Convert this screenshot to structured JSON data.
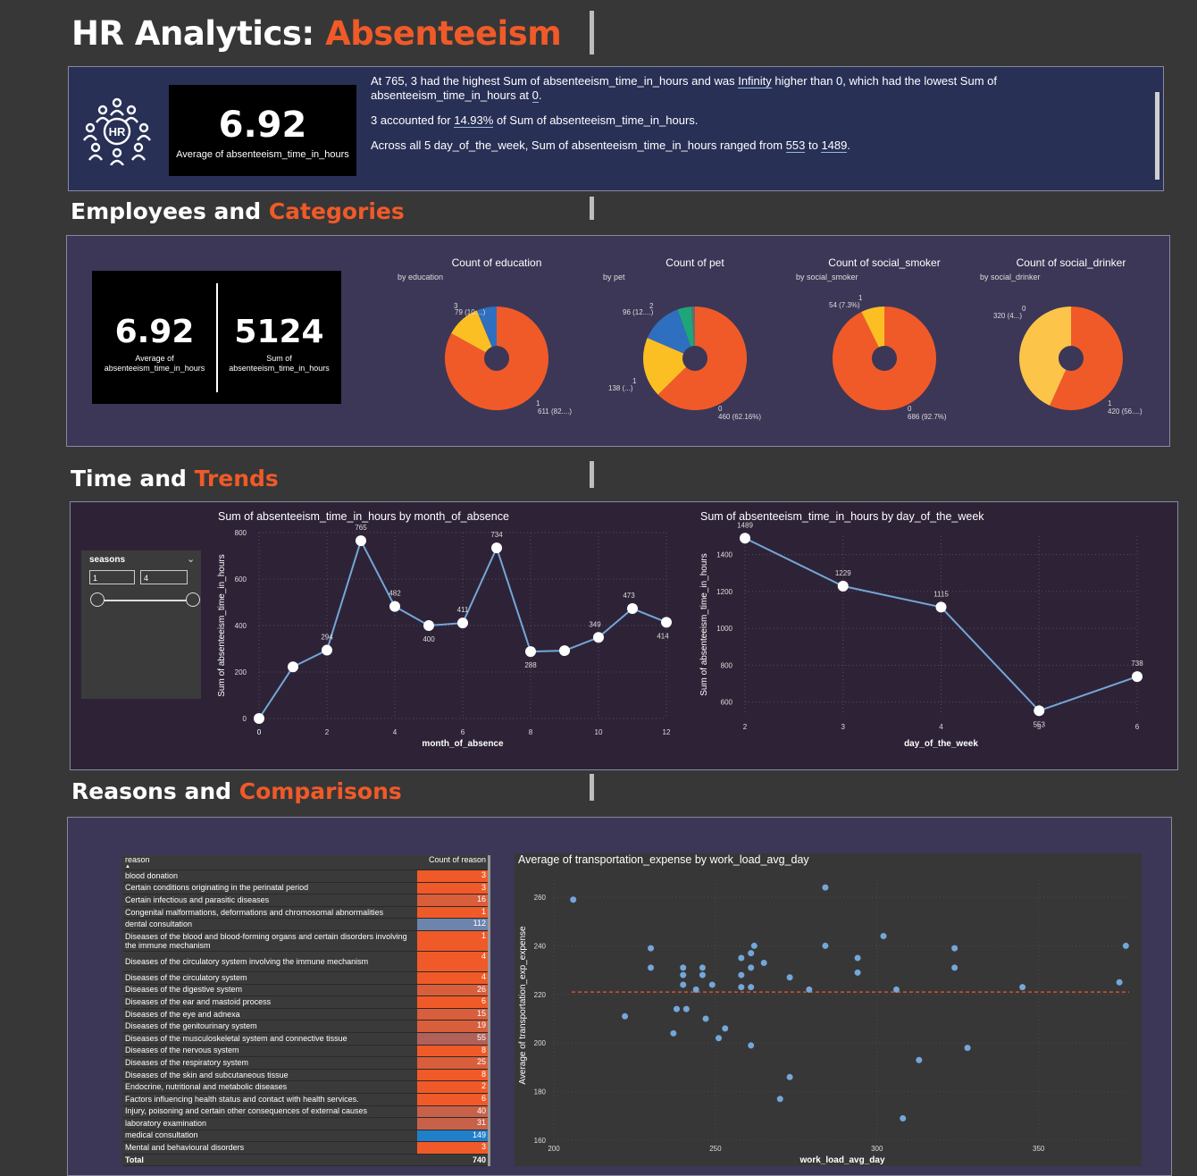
{
  "header": {
    "title_main": "HR Analytics: ",
    "title_accent": "Absenteeism"
  },
  "top_kpi": {
    "value": "6.92",
    "label": "Average of absenteeism_time_in_hours"
  },
  "insights": {
    "line1a": "At 765, 3 had the highest Sum of absenteeism_time_in_hours and was ",
    "line1b": "Infinity",
    "line1c": " higher than 0, which had the lowest Sum of",
    "line1d": "absenteeism_time_in_hours at ",
    "line1e": "0",
    "line1f": ".",
    "line2a": "3 accounted for ",
    "line2b": "14.93%",
    "line2c": " of Sum of absenteeism_time_in_hours.",
    "line3a": "Across all 5 day_of_the_week, Sum of absenteeism_time_in_hours ranged from ",
    "line3b": "553",
    "line3c": " to ",
    "line3d": "1489",
    "line3e": "."
  },
  "sections": {
    "employees_a": "Employees and ",
    "employees_b": "Categories",
    "time_a": "Time and ",
    "time_b": "Trends",
    "reasons_a": "Reasons and ",
    "reasons_b": "Comparisons"
  },
  "emp_kpis": [
    {
      "value": "6.92",
      "label1": "Average of",
      "label2": "absenteeism_time_in_hours"
    },
    {
      "value": "5124",
      "label1": "Sum of",
      "label2": "absenteeism_time_in_hours"
    }
  ],
  "donuts": [
    {
      "title": "Count of education",
      "subtitle": "by education",
      "slices": [
        {
          "name": "1",
          "value": 611,
          "color": "#f05a28"
        },
        {
          "name": "3",
          "value": 79,
          "color": "#fbbf24"
        },
        {
          "name": "2",
          "value": 46,
          "color": "#2f6fbf"
        }
      ],
      "labels": [
        {
          "text1": "3",
          "text2": "79 (10....)"
        },
        {
          "text1": "1",
          "text2": "611 (82....)"
        }
      ]
    },
    {
      "title": "Count of pet",
      "subtitle": "by pet",
      "slices": [
        {
          "name": "0",
          "value": 460,
          "color": "#f05a28"
        },
        {
          "name": "1",
          "value": 138,
          "color": "#fbbf24"
        },
        {
          "name": "2",
          "value": 96,
          "color": "#2f6fbf"
        },
        {
          "name": "4",
          "value": 32,
          "color": "#1ea67a"
        },
        {
          "name": "5",
          "value": 8,
          "color": "#6b6b6b"
        }
      ],
      "labels": [
        {
          "text1": "2",
          "text2": "96 (12....)"
        },
        {
          "text1": "1",
          "text2": "138 (...)"
        },
        {
          "text1": "0",
          "text2": "460 (62.16%)"
        }
      ]
    },
    {
      "title": "Count of social_smoker",
      "subtitle": "by social_smoker",
      "slices": [
        {
          "name": "0",
          "value": 686,
          "color": "#f05a28"
        },
        {
          "name": "1",
          "value": 54,
          "color": "#fbbf24"
        }
      ],
      "labels": [
        {
          "text1": "1",
          "text2": "54 (7.3%)"
        },
        {
          "text1": "0",
          "text2": "686 (92.7%)"
        }
      ]
    },
    {
      "title": "Count of social_drinker",
      "subtitle": "by social_drinker",
      "slices": [
        {
          "name": "1",
          "value": 420,
          "color": "#f05a28"
        },
        {
          "name": "0",
          "value": 320,
          "color": "#fdc44a"
        }
      ],
      "labels": [
        {
          "text1": "0",
          "text2": "320 (4...)"
        },
        {
          "text1": "1",
          "text2": "420 (56....)"
        }
      ]
    }
  ],
  "slicer": {
    "title": "seasons",
    "min": "1",
    "max": "4",
    "chevron": "chevron-down-icon"
  },
  "chart_data": [
    {
      "type": "line",
      "title": "Sum of absenteeism_time_in_hours by month_of_absence",
      "xlabel": "month_of_absence",
      "ylabel": "Sum of absenteeism_time_in_hours",
      "x": [
        0,
        1,
        2,
        3,
        4,
        5,
        6,
        7,
        8,
        9,
        10,
        11,
        12
      ],
      "values": [
        0,
        222,
        294,
        765,
        482,
        400,
        411,
        734,
        288,
        292,
        349,
        473,
        414
      ],
      "labels": [
        "0",
        "",
        "294",
        "765",
        "482",
        "400",
        "411",
        "734",
        "288",
        "",
        "349",
        "473",
        "414"
      ],
      "xticks": [
        "0",
        "2",
        "4",
        "6",
        "8",
        "10",
        "12"
      ],
      "yticks": [
        "0",
        "200",
        "400",
        "600",
        "800"
      ],
      "xlim": [
        0,
        12
      ],
      "ylim": [
        0,
        800
      ]
    },
    {
      "type": "line",
      "title": "Sum of absenteeism_time_in_hours by day_of_the_week",
      "xlabel": "day_of_the_week",
      "ylabel": "Sum of absenteeism_time_in_hours",
      "x": [
        2,
        3,
        4,
        5,
        6
      ],
      "values": [
        1489,
        1229,
        1115,
        553,
        738
      ],
      "labels": [
        "1489",
        "1229",
        "1115",
        "553",
        "738"
      ],
      "xticks": [
        "2",
        "3",
        "4",
        "5",
        "6"
      ],
      "yticks": [
        "600",
        "800",
        "1000",
        "1200",
        "1400"
      ],
      "xlim": [
        2,
        6
      ],
      "ylim": [
        540,
        1500
      ]
    },
    {
      "type": "table",
      "header": [
        "reason",
        "Count of reason"
      ],
      "rows": [
        [
          "blood donation",
          "3"
        ],
        [
          "Certain conditions originating in the perinatal period",
          "3"
        ],
        [
          "Certain infectious and parasitic diseases",
          "16"
        ],
        [
          "Congenital malformations, deformations and chromosomal abnormalities",
          "1"
        ],
        [
          "dental consultation",
          "112"
        ],
        [
          "Diseases of the blood and blood-forming organs and certain disorders involving the immune mechanism",
          "1"
        ],
        [
          "Diseases of the circulatory system involving the immune mechanism",
          "4"
        ],
        [
          "Diseases of the circulatory system",
          "4"
        ],
        [
          "Diseases of the digestive system",
          "26"
        ],
        [
          "Diseases of the ear and mastoid process",
          "6"
        ],
        [
          "Diseases of the eye and adnexa",
          "15"
        ],
        [
          "Diseases of the genitourinary system",
          "19"
        ],
        [
          "Diseases of the musculoskeletal system and connective tissue",
          "55"
        ],
        [
          "Diseases of the nervous system",
          "8"
        ],
        [
          "Diseases of the respiratory system",
          "25"
        ],
        [
          "Diseases of the skin and subcutaneous tissue",
          "8"
        ],
        [
          "Endocrine, nutritional and metabolic diseases",
          "2"
        ],
        [
          "Factors influencing health status and contact with health services.",
          "6"
        ],
        [
          "Injury, poisoning and certain other consequences of external causes",
          "40"
        ],
        [
          "laboratory examination",
          "31"
        ],
        [
          "medical consultation",
          "149"
        ],
        [
          "Mental and behavioural disorders",
          "3"
        ]
      ],
      "total": [
        "Total",
        "740"
      ]
    },
    {
      "type": "scatter",
      "title": "Average of transportation_expense by work_load_avg_day",
      "xlabel": "work_load_avg_day",
      "ylabel": "Average of transportation_exp_expense",
      "xticks": [
        "200",
        "250",
        "300",
        "350"
      ],
      "yticks": [
        "160",
        "180",
        "200",
        "220",
        "240",
        "260"
      ],
      "xlim": [
        200,
        378
      ],
      "ylim": [
        160,
        267
      ],
      "trend_y": 221,
      "points": [
        [
          206,
          259
        ],
        [
          222,
          211
        ],
        [
          230,
          239
        ],
        [
          230,
          231
        ],
        [
          237,
          204
        ],
        [
          238,
          214
        ],
        [
          240,
          231
        ],
        [
          240,
          228
        ],
        [
          240,
          224
        ],
        [
          241,
          214
        ],
        [
          244,
          222
        ],
        [
          246,
          231
        ],
        [
          246,
          228
        ],
        [
          247,
          210
        ],
        [
          249,
          224
        ],
        [
          251,
          202
        ],
        [
          253,
          206
        ],
        [
          258,
          223
        ],
        [
          258,
          228
        ],
        [
          258,
          235
        ],
        [
          261,
          237
        ],
        [
          261,
          231
        ],
        [
          261,
          199
        ],
        [
          261,
          223
        ],
        [
          262,
          240
        ],
        [
          265,
          233
        ],
        [
          270,
          177
        ],
        [
          273,
          186
        ],
        [
          273,
          227
        ],
        [
          279,
          222
        ],
        [
          284,
          264
        ],
        [
          284,
          240
        ],
        [
          294,
          235
        ],
        [
          294,
          229
        ],
        [
          302,
          244
        ],
        [
          306,
          222
        ],
        [
          308,
          169
        ],
        [
          313,
          193
        ],
        [
          324,
          239
        ],
        [
          324,
          231
        ],
        [
          328,
          198
        ],
        [
          345,
          223
        ],
        [
          375,
          225
        ],
        [
          377,
          240
        ]
      ]
    }
  ]
}
